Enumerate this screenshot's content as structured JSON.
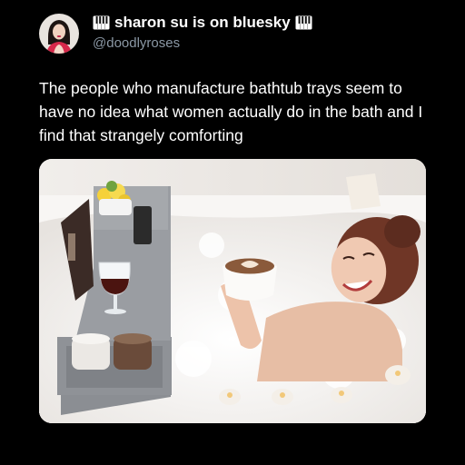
{
  "post": {
    "author": {
      "display_name": "sharon su is on bluesky",
      "handle": "@doodlyroses",
      "avatar_icon": "user-avatar",
      "name_decoration_icon": "piano-keys-emoji"
    },
    "text": "The people who manufacture bathtub trays seem to have no idea what women actually do in the bath and I find that strangely comforting",
    "media": {
      "image_kind": "photo",
      "tray_icon": "bathtub-tray",
      "mug_icon": "coffee-latte-icon",
      "wine_icon": "wine-glass-icon",
      "candle_icon": "candle-icon"
    }
  },
  "colors": {
    "background": "#000000",
    "text": "#ffffff",
    "handle": "#8b98a5",
    "tray": "#8f9297",
    "bath_foam": "#fbfaf8",
    "wall": "#eeeae6"
  }
}
